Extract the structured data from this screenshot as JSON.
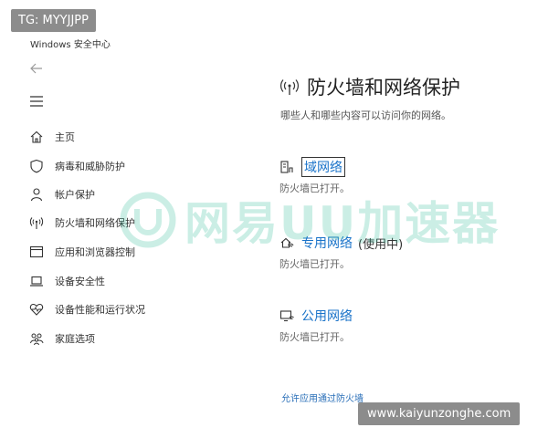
{
  "overlay_top": "TG: MYYJJPP",
  "overlay_bottom": "www.kaiyunzonghe.com",
  "app": {
    "title": "Windows 安全中心"
  },
  "sidebar": {
    "items": [
      {
        "label": "主页",
        "icon": "home-icon"
      },
      {
        "label": "病毒和威胁防护",
        "icon": "shield-icon"
      },
      {
        "label": "帐户保护",
        "icon": "person-icon"
      },
      {
        "label": "防火墙和网络保护",
        "icon": "wireless-icon"
      },
      {
        "label": "应用和浏览器控制",
        "icon": "browser-window-icon"
      },
      {
        "label": "设备安全性",
        "icon": "laptop-icon"
      },
      {
        "label": "设备性能和运行状况",
        "icon": "heart-icon"
      },
      {
        "label": "家庭选项",
        "icon": "family-icon"
      }
    ]
  },
  "main": {
    "title": "防火墙和网络保护",
    "subtitle": "哪些人和哪些内容可以访问你的网络。",
    "networks": [
      {
        "name": "域网络",
        "status": "防火墙已打开。",
        "active": ""
      },
      {
        "name": "专用网络",
        "status": "防火墙已打开。",
        "active": "(使用中)"
      },
      {
        "name": "公用网络",
        "status": "防火墙已打开。",
        "active": ""
      }
    ],
    "allow_link": "允许应用通过防火墙"
  },
  "watermark": {
    "text": "网易UU加速器"
  },
  "colors": {
    "link": "#1a73c9",
    "watermark": "#19b58e"
  }
}
